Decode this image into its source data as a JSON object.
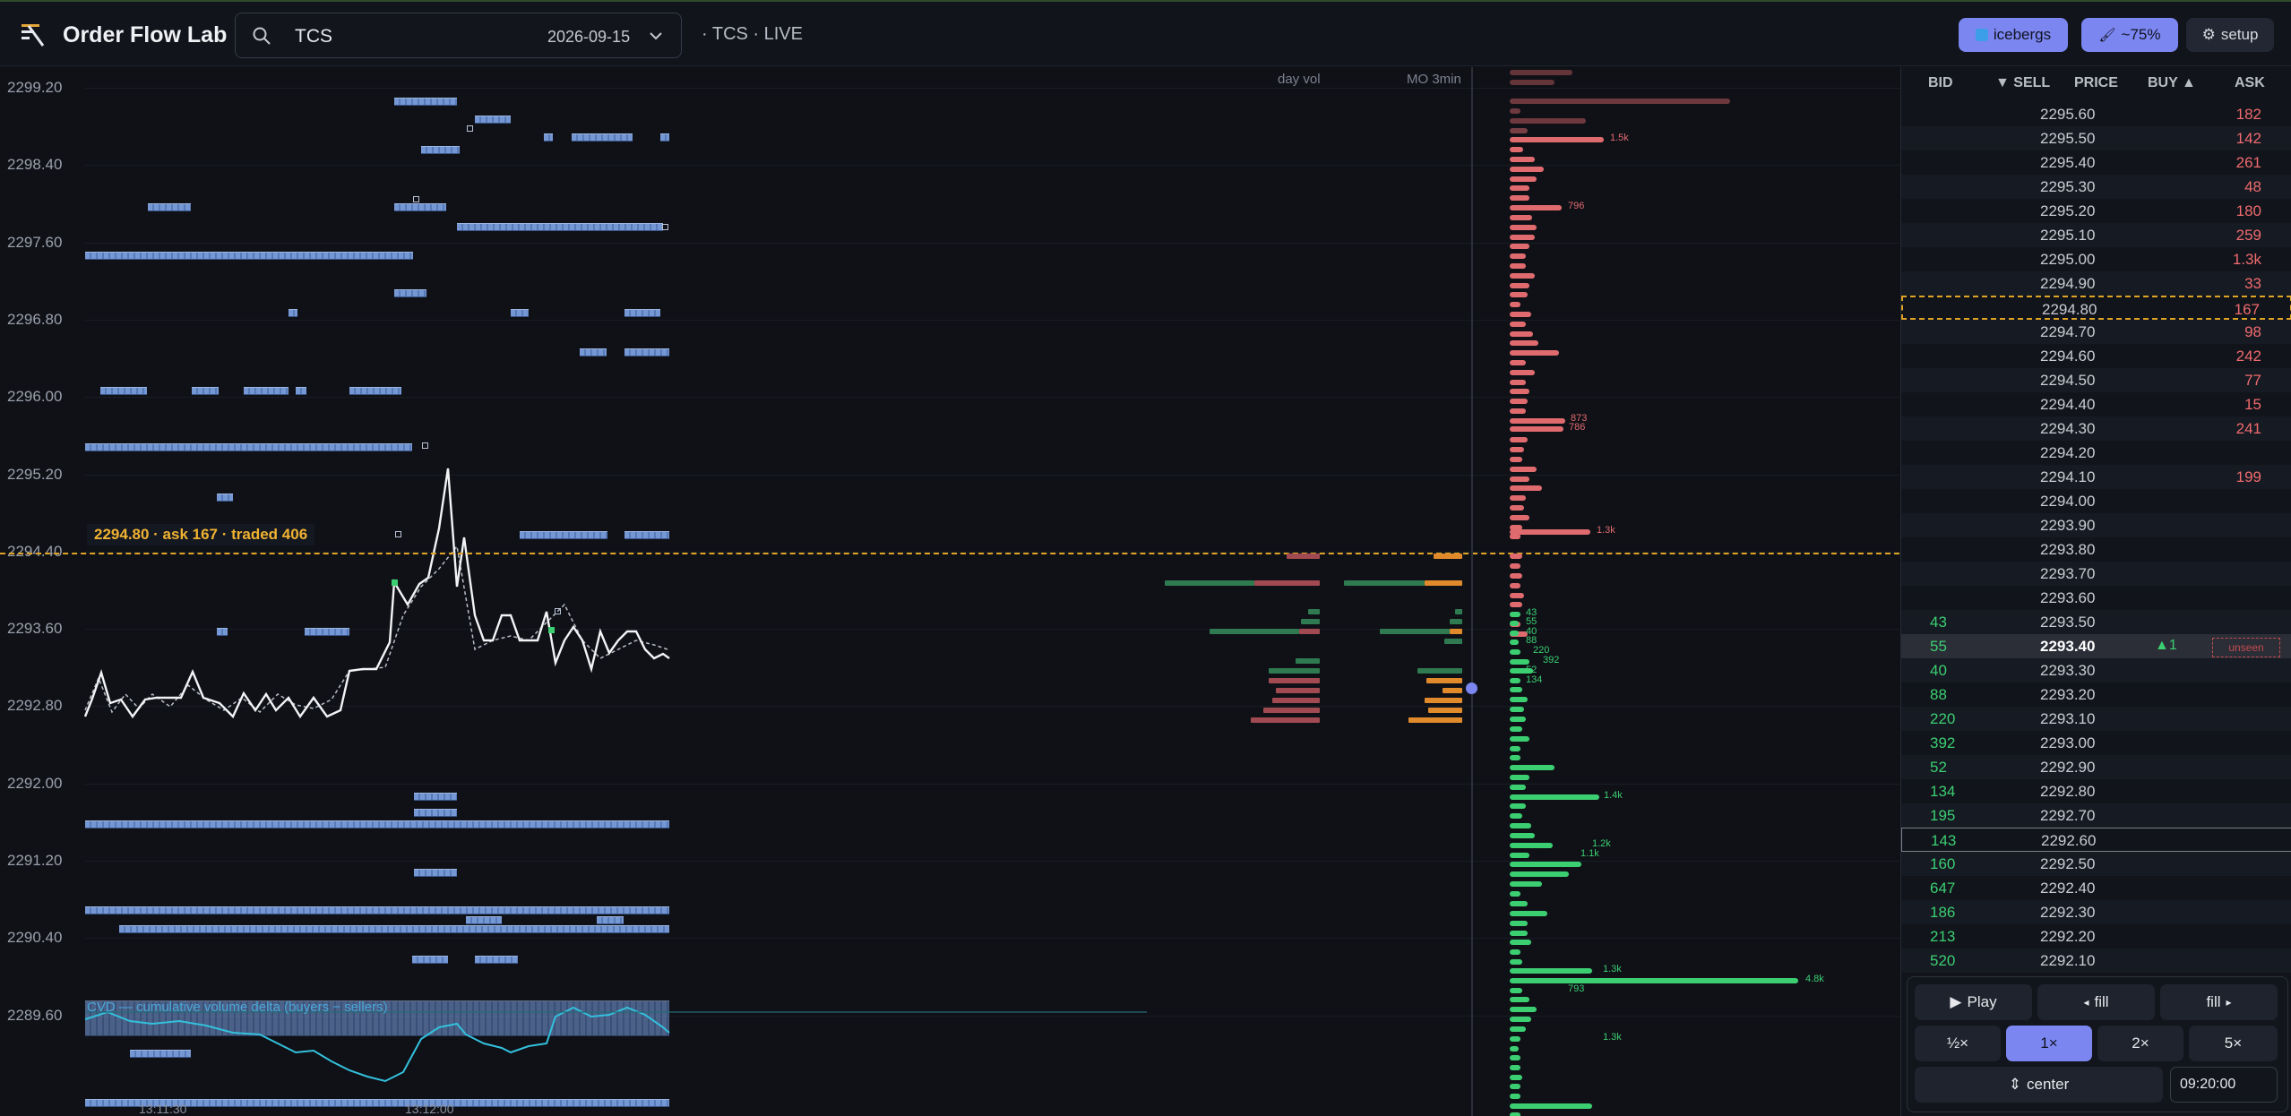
{
  "app": {
    "title": "Order Flow Lab"
  },
  "search": {
    "value": "TCS",
    "date": "2026-09-15"
  },
  "status": {
    "label": "· TCS · LIVE"
  },
  "toolbar": {
    "icebergs_label": "icebergs",
    "opacity_label": "~75%",
    "setup_label": "setup"
  },
  "chart": {
    "y_labels": [
      "2299.20",
      "2298.40",
      "2297.60",
      "2296.80",
      "2296.00",
      "2295.20",
      "2294.40",
      "2293.60",
      "2292.80",
      "2292.00",
      "2291.20",
      "2290.40",
      "2289.60"
    ],
    "price_tag": "2294.80 · ask 167 · traded 406",
    "col_day_vol": "day vol",
    "col_mo": "MO 3min",
    "cvd_label": "CVD — cumulative volume delta (buyers − sellers)",
    "x_labels": [
      "13:11:30",
      "13:12:00"
    ],
    "ask_depth_labels": [
      "1.5k",
      "796",
      "873",
      "786",
      "1.3k"
    ],
    "bid_depth_labels": [
      "43",
      "55",
      "40",
      "88",
      "220",
      "392",
      "52",
      "134",
      "1.4k",
      "1.2k",
      "1.1k",
      "1.3k",
      "4.8k",
      "793",
      "1.3k"
    ],
    "colors": {
      "ask": "#e06b6f",
      "bid": "#3ccf72",
      "price": "#e0a424",
      "iceberg": "#7ea3e4"
    }
  },
  "dom": {
    "headers": {
      "bid": "BID",
      "sell": "▼ SELL",
      "price": "PRICE",
      "buy": "BUY ▲",
      "ask": "ASK"
    },
    "rows": [
      {
        "bid": "",
        "price": "2295.60",
        "ask": "182"
      },
      {
        "bid": "",
        "price": "2295.50",
        "ask": "142"
      },
      {
        "bid": "",
        "price": "2295.40",
        "ask": "261"
      },
      {
        "bid": "",
        "price": "2295.30",
        "ask": "48"
      },
      {
        "bid": "",
        "price": "2295.20",
        "ask": "180"
      },
      {
        "bid": "",
        "price": "2295.10",
        "ask": "259"
      },
      {
        "bid": "",
        "price": "2295.00",
        "ask": "1.3k"
      },
      {
        "bid": "",
        "price": "2294.90",
        "ask": "33"
      },
      {
        "bid": "",
        "price": "2294.80",
        "ask": "167"
      },
      {
        "bid": "",
        "price": "2294.70",
        "ask": "98"
      },
      {
        "bid": "",
        "price": "2294.60",
        "ask": "242"
      },
      {
        "bid": "",
        "price": "2294.50",
        "ask": "77"
      },
      {
        "bid": "",
        "price": "2294.40",
        "ask": "15"
      },
      {
        "bid": "",
        "price": "2294.30",
        "ask": "241"
      },
      {
        "bid": "",
        "price": "2294.20",
        "ask": ""
      },
      {
        "bid": "",
        "price": "2294.10",
        "ask": "199"
      },
      {
        "bid": "",
        "price": "2294.00",
        "ask": ""
      },
      {
        "bid": "",
        "price": "2293.90",
        "ask": ""
      },
      {
        "bid": "",
        "price": "2293.80",
        "ask": ""
      },
      {
        "bid": "",
        "price": "2293.70",
        "ask": ""
      },
      {
        "bid": "",
        "price": "2293.60",
        "ask": ""
      },
      {
        "bid": "43",
        "price": "2293.50",
        "ask": ""
      },
      {
        "bid": "55",
        "price": "2293.40",
        "ask": ""
      },
      {
        "bid": "40",
        "price": "2293.30",
        "ask": ""
      },
      {
        "bid": "88",
        "price": "2293.20",
        "ask": ""
      },
      {
        "bid": "220",
        "price": "2293.10",
        "ask": ""
      },
      {
        "bid": "392",
        "price": "2293.00",
        "ask": ""
      },
      {
        "bid": "52",
        "price": "2292.90",
        "ask": ""
      },
      {
        "bid": "134",
        "price": "2292.80",
        "ask": ""
      },
      {
        "bid": "195",
        "price": "2292.70",
        "ask": ""
      },
      {
        "bid": "143",
        "price": "2292.60",
        "ask": ""
      },
      {
        "bid": "160",
        "price": "2292.50",
        "ask": ""
      },
      {
        "bid": "647",
        "price": "2292.40",
        "ask": ""
      },
      {
        "bid": "186",
        "price": "2292.30",
        "ask": ""
      },
      {
        "bid": "213",
        "price": "2292.20",
        "ask": ""
      },
      {
        "bid": "520",
        "price": "2292.10",
        "ask": ""
      }
    ],
    "current_buy": "1",
    "unseen_label": "unseen"
  },
  "controls": {
    "play": "Play",
    "fill_back": "fill",
    "fill_fwd": "fill",
    "speeds": [
      "½×",
      "1×",
      "2×",
      "5×"
    ],
    "active_speed": "1×",
    "center": "center",
    "time": "09:20:00"
  }
}
